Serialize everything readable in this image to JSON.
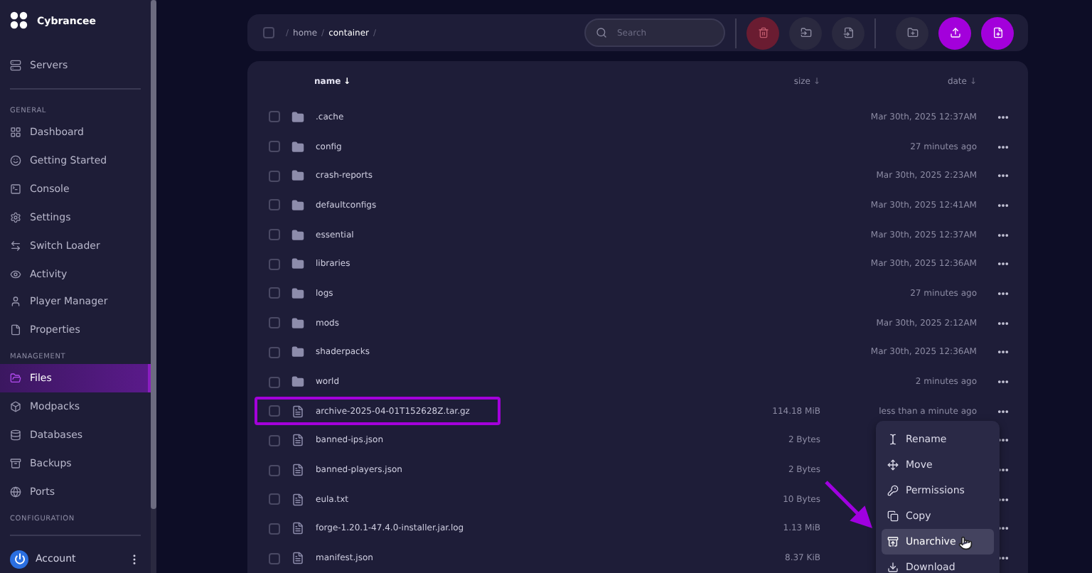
{
  "brand": {
    "name": "Cybrancee"
  },
  "sidebar": {
    "top_items": [
      {
        "label": "Servers",
        "selected": false
      }
    ],
    "sections": [
      {
        "heading": "GENERAL",
        "items": [
          {
            "label": "Dashboard",
            "selected": false
          },
          {
            "label": "Getting Started",
            "selected": false
          },
          {
            "label": "Console",
            "selected": false
          },
          {
            "label": "Settings",
            "selected": false
          },
          {
            "label": "Switch Loader",
            "selected": false
          },
          {
            "label": "Activity",
            "selected": false
          },
          {
            "label": "Player Manager",
            "selected": false
          },
          {
            "label": "Properties",
            "selected": false
          }
        ]
      },
      {
        "heading": "MANAGEMENT",
        "items": [
          {
            "label": "Files",
            "selected": true
          },
          {
            "label": "Modpacks",
            "selected": false
          },
          {
            "label": "Databases",
            "selected": false
          },
          {
            "label": "Backups",
            "selected": false
          },
          {
            "label": "Ports",
            "selected": false
          }
        ]
      },
      {
        "heading": "CONFIGURATION"
      }
    ],
    "account": {
      "label": "Account"
    }
  },
  "toolbar": {
    "select_all": {
      "checked": false
    },
    "separator": "/",
    "breadcrumb": [
      {
        "label": "home",
        "current": false
      },
      {
        "label": "container",
        "current": true
      }
    ],
    "search": {
      "placeholder": "Search"
    },
    "actions": [
      {
        "kind": "danger"
      },
      {
        "kind": "muted"
      },
      {
        "kind": "muted"
      },
      {
        "kind": "divider"
      },
      {
        "kind": "muted"
      },
      {
        "kind": "primary"
      },
      {
        "kind": "primary"
      }
    ]
  },
  "table": {
    "columns": [
      {
        "label": "name",
        "sort_arrow": "↓",
        "active": true
      },
      {
        "label": "size",
        "sort_arrow": "↓",
        "active": false
      },
      {
        "label": "date",
        "sort_arrow": "↓",
        "active": false
      }
    ],
    "rows": [
      {
        "kind": "folder",
        "name": ".cache",
        "date": "Mar 30th, 2025 12:37AM",
        "checked": false,
        "highlighted": false
      },
      {
        "kind": "folder",
        "name": "config",
        "date": "27 minutes ago",
        "checked": false,
        "highlighted": false
      },
      {
        "kind": "folder",
        "name": "crash-reports",
        "date": "Mar 30th, 2025 2:23AM",
        "checked": false,
        "highlighted": false
      },
      {
        "kind": "folder",
        "name": "defaultconfigs",
        "date": "Mar 30th, 2025 12:41AM",
        "checked": false,
        "highlighted": false
      },
      {
        "kind": "folder",
        "name": "essential",
        "date": "Mar 30th, 2025 12:37AM",
        "checked": false,
        "highlighted": false
      },
      {
        "kind": "folder",
        "name": "libraries",
        "date": "Mar 30th, 2025 12:36AM",
        "checked": false,
        "highlighted": false
      },
      {
        "kind": "folder",
        "name": "logs",
        "date": "27 minutes ago",
        "checked": false,
        "highlighted": false
      },
      {
        "kind": "folder",
        "name": "mods",
        "date": "Mar 30th, 2025 2:12AM",
        "checked": false,
        "highlighted": false
      },
      {
        "kind": "folder",
        "name": "shaderpacks",
        "date": "Mar 30th, 2025 12:36AM",
        "checked": false,
        "highlighted": false
      },
      {
        "kind": "folder",
        "name": "world",
        "date": "2 minutes ago",
        "checked": false,
        "highlighted": false
      },
      {
        "kind": "file",
        "name": "archive-2025-04-01T152628Z.tar.gz",
        "size": "114.18 MiB",
        "date": "less than a minute ago",
        "checked": false,
        "highlighted": true
      },
      {
        "kind": "file",
        "name": "banned-ips.json",
        "size": "2 Bytes",
        "checked": false,
        "highlighted": false
      },
      {
        "kind": "file",
        "name": "banned-players.json",
        "size": "2 Bytes",
        "checked": false,
        "highlighted": false
      },
      {
        "kind": "file",
        "name": "eula.txt",
        "size": "10 Bytes",
        "checked": false,
        "highlighted": false
      },
      {
        "kind": "file",
        "name": "forge-1.20.1-47.4.0-installer.jar.log",
        "size": "1.13 MiB",
        "checked": false,
        "highlighted": false
      },
      {
        "kind": "file",
        "name": "manifest.json",
        "size": "8.37 KiB",
        "checked": false,
        "highlighted": false
      }
    ]
  },
  "context_menu": {
    "items": [
      {
        "label": "Rename",
        "selected": false
      },
      {
        "label": "Move",
        "selected": false
      },
      {
        "label": "Permissions",
        "selected": false
      },
      {
        "label": "Copy",
        "selected": false
      },
      {
        "label": "Unarchive",
        "selected": true
      },
      {
        "label": "Download",
        "selected": false
      }
    ]
  }
}
